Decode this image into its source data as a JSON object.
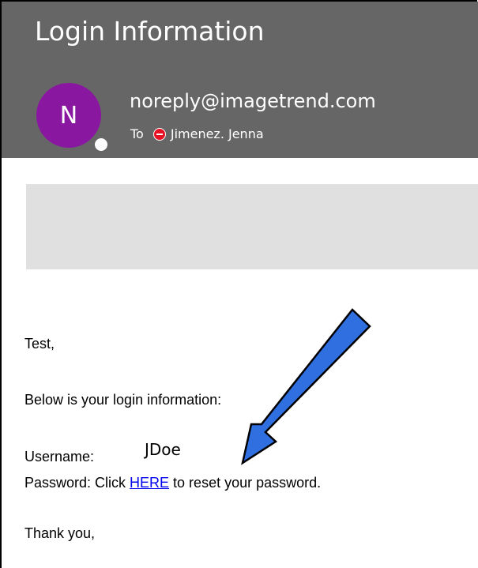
{
  "email": {
    "subject": "Login Information",
    "avatar_initial": "N",
    "sender": "noreply@imagetrend.com",
    "to_label": "To",
    "recipient": "Jimenez. Jenna"
  },
  "body": {
    "greeting": "Test,",
    "intro": "Below is your login information:",
    "username_label": "Username:",
    "username_value": "JDoe",
    "password_prefix": "Password: Click ",
    "password_link": "HERE",
    "password_suffix": " to reset your password.",
    "closing": "Thank you,"
  },
  "colors": {
    "header_bg": "#666666",
    "avatar_bg": "#8a17a0",
    "banner_bg": "#e0e0e0",
    "arrow_fill": "#2f6fe0",
    "link": "#0000ee"
  },
  "icons": {
    "presence": "presence-status-icon",
    "blocked": "blocked-recipient-icon",
    "arrow": "annotation-arrow-icon"
  }
}
